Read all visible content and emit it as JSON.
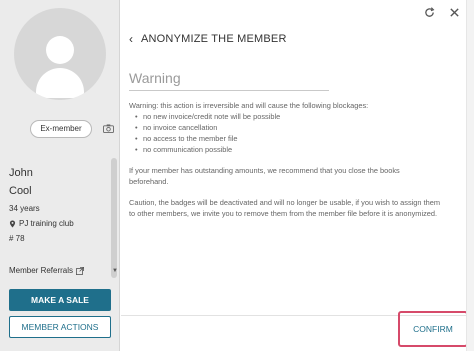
{
  "sidebar": {
    "status_badge": "Ex-member",
    "first_name": "John",
    "last_name": "Cool",
    "age": "34 years",
    "club": "PJ training club",
    "member_number": "# 78",
    "referrals_label": "Member Referrals",
    "make_sale_label": "MAKE A SALE",
    "member_actions_label": "MEMBER ACTIONS"
  },
  "main": {
    "title": "ANONYMIZE THE MEMBER",
    "section_heading": "Warning",
    "warning_intro": "Warning: this action is irreversible and will cause the following blockages:",
    "blockages": [
      "no new invoice/credit note will be possible",
      "no invoice cancellation",
      "no access to the member file",
      "no communication possible"
    ],
    "paragraph_outstanding": "If your member has outstanding amounts, we recommend that you close the books beforehand.",
    "paragraph_badges": "Caution, the badges will be deactivated and will no longer be usable, if you wish to assign them to other members, we invite you to remove them from the member file before it is anonymized.",
    "confirm_label": "CONFIRM"
  },
  "colors": {
    "primary": "#1f6f8b",
    "highlight": "#d64a6a",
    "sidebar_bg": "#ebebeb"
  }
}
